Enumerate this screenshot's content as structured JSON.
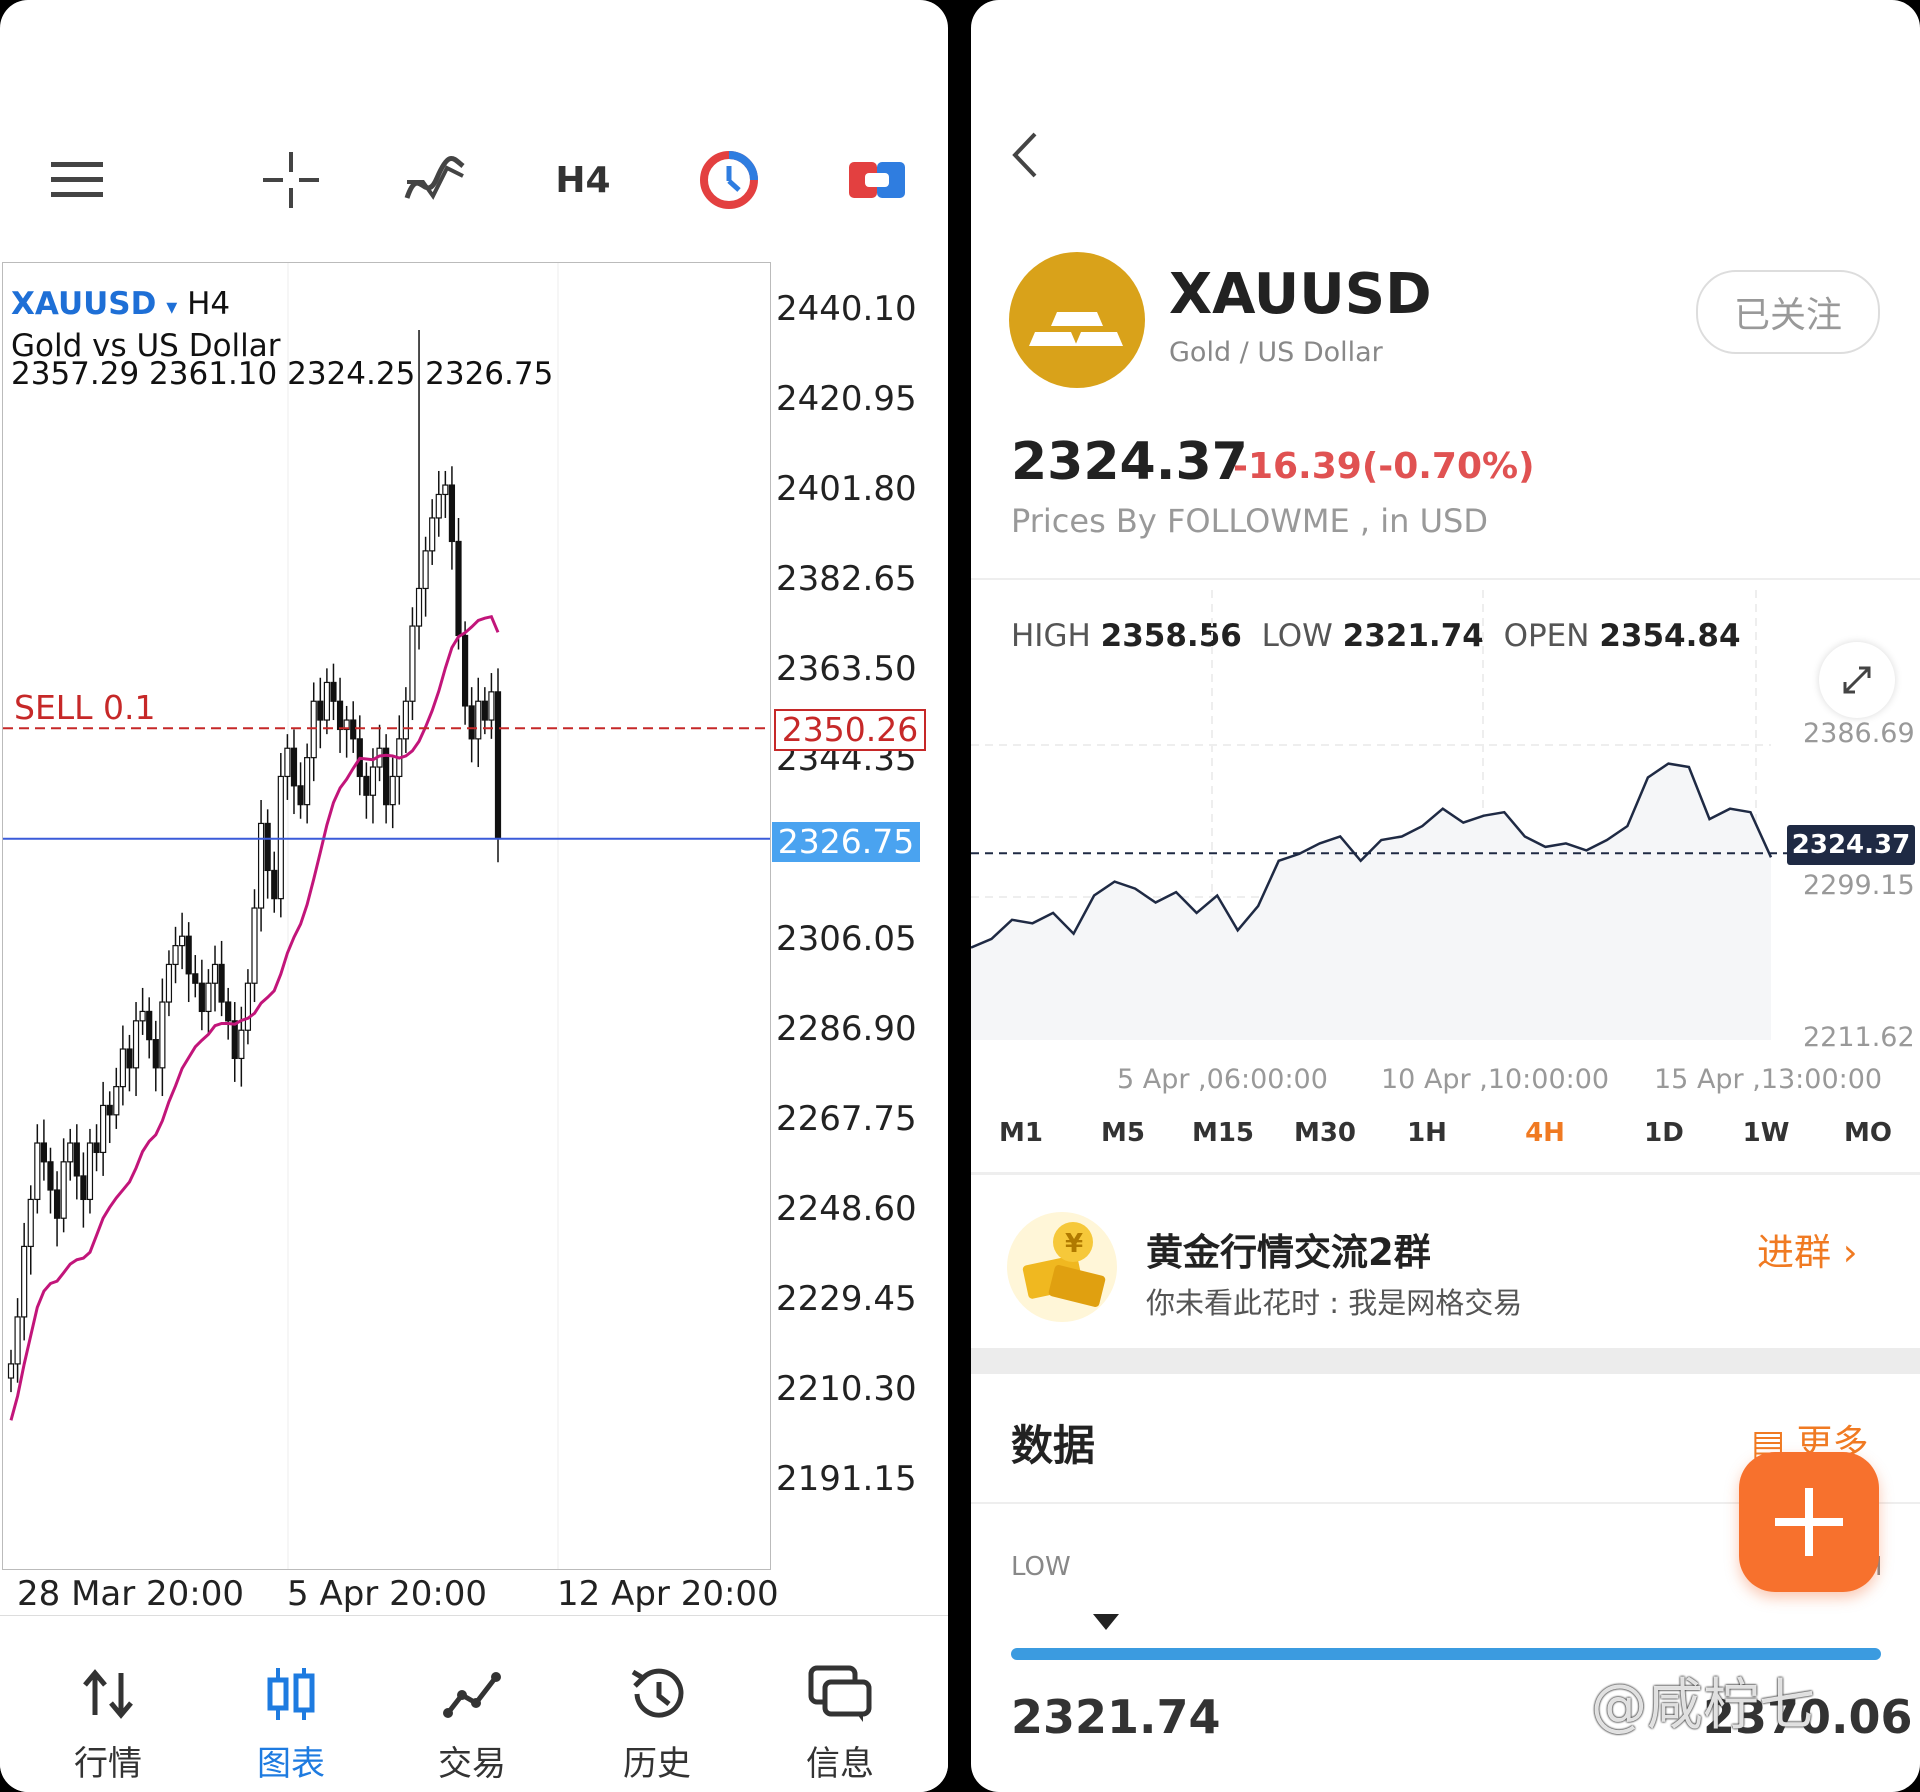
{
  "left": {
    "toolbar": {
      "menu_icon": "hamburger-menu-icon",
      "crosshair_icon": "crosshair-icon",
      "indicators_icon": "indicator-wave-icon",
      "timeframe": "H4",
      "objects_icon": "clock-objects-icon",
      "trade_icon": "one-click-trading-icon"
    },
    "chart": {
      "symbol": "XAUUSD",
      "symbol_caret": "▾",
      "timeframe": "H4",
      "description": "Gold vs US Dollar",
      "ohlc": "2357.29 2361.10 2324.25 2326.75",
      "sell_label": "SELL 0.1",
      "sell_price": "2350.26",
      "bid_price": "2326.75",
      "price_axis": [
        "2440.10",
        "2420.95",
        "2401.80",
        "2382.65",
        "2363.50",
        "2344.35",
        "2306.05",
        "2286.90",
        "2267.75",
        "2248.60",
        "2229.45",
        "2210.30",
        "2191.15"
      ],
      "date_axis": [
        "28 Mar 20:00",
        "5 Apr 20:00",
        "12 Apr 20:00"
      ],
      "colors": {
        "bull_bear": "#111111",
        "ma": "#c2157a",
        "sell_line": "#c62828",
        "bid_line": "#3a5bd9",
        "bid_badge": "#4aa3f0"
      }
    },
    "nav": [
      {
        "label": "行情",
        "icon": "quotes-arrows-icon",
        "active": false
      },
      {
        "label": "图表",
        "icon": "chart-candles-icon",
        "active": true
      },
      {
        "label": "交易",
        "icon": "trade-line-icon",
        "active": false
      },
      {
        "label": "历史",
        "icon": "history-clock-icon",
        "active": false
      },
      {
        "label": "信息",
        "icon": "messages-icon",
        "active": false
      }
    ]
  },
  "right": {
    "back_icon": "back-chevron-icon",
    "logo_icon": "gold-bars-icon",
    "symbol": "XAUUSD",
    "subtitle": "Gold / US Dollar",
    "follow_label": "已关注",
    "price": "2324.37",
    "change": "-16.39(-0.70%)",
    "prices_by": "Prices By FOLLOWME , in USD",
    "stats": {
      "high_label": "HIGH",
      "high": "2358.56",
      "low_label": "LOW",
      "low": "2321.74",
      "open_label": "OPEN",
      "open": "2354.84"
    },
    "expand_icon": "expand-arrows-icon",
    "chart_y_labels": [
      "2386.69",
      "2299.15",
      "2211.62"
    ],
    "chart_current": "2324.37",
    "chart_x_labels": [
      "5 Apr ,06:00:00",
      "10 Apr ,10:00:00",
      "15 Apr ,13:00:00"
    ],
    "timeframes": [
      "M1",
      "M5",
      "M15",
      "M30",
      "1H",
      "4H",
      "1D",
      "1W",
      "MO"
    ],
    "active_timeframe": "4H",
    "group": {
      "title": "黄金行情交流2群",
      "message": "你未看此花时 : 我是网格交易",
      "join": "进群",
      "icon": "gold-coin-bars-icon"
    },
    "data_section": {
      "title": "数据",
      "more": "更多",
      "low_label": "LOW",
      "high_label_partial": "H",
      "low_value": "2321.74",
      "high_value_partial": "2370.06"
    },
    "fab_icon": "plus-icon",
    "watermark": "@咸柠七",
    "accent": "#f07a22",
    "negative": "#e05252",
    "range_bar": "#3b9be0"
  }
}
